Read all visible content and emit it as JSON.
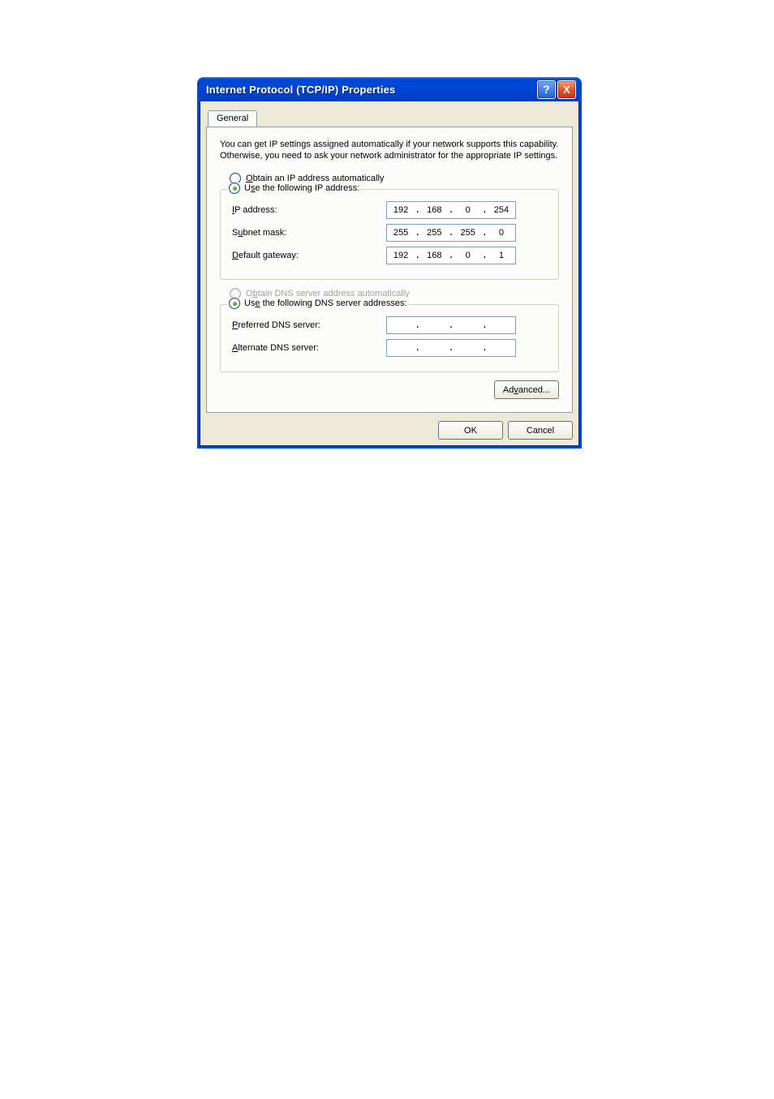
{
  "titlebar": {
    "title": "Internet Protocol (TCP/IP) Properties",
    "help_tooltip": "?",
    "close_tooltip": "X"
  },
  "tab": {
    "general_label": "General"
  },
  "description": "You can get IP settings assigned automatically if your network supports this capability. Otherwise, you need to ask your network administrator for the appropriate IP settings.",
  "ip_section": {
    "radio_auto_o": "O",
    "radio_auto_rest": "btain an IP address automatically",
    "radio_manual_s": "s",
    "radio_manual_pre": "U",
    "radio_manual_rest": "e the following IP address:",
    "ip_label_i": "I",
    "ip_label_rest": "P address:",
    "subnet_label_pre": "S",
    "subnet_label_u": "u",
    "subnet_label_rest": "bnet mask:",
    "gateway_label_d": "D",
    "gateway_label_rest": "efault gateway:",
    "ip": {
      "a": "192",
      "b": "168",
      "c": "0",
      "d": "254"
    },
    "mask": {
      "a": "255",
      "b": "255",
      "c": "255",
      "d": "0"
    },
    "gw": {
      "a": "192",
      "b": "168",
      "c": "0",
      "d": "1"
    }
  },
  "dns_section": {
    "radio_auto_pre": "O",
    "radio_auto_b": "b",
    "radio_auto_rest": "tain DNS server address automatically",
    "radio_manual_pre": "Us",
    "radio_manual_e": "e",
    "radio_manual_rest": " the following DNS server addresses:",
    "pref_p": "P",
    "pref_rest": "referred DNS server:",
    "alt_a": "A",
    "alt_rest": "lternate DNS server:",
    "pref": {
      "a": "",
      "b": "",
      "c": "",
      "d": ""
    },
    "alt": {
      "a": "",
      "b": "",
      "c": "",
      "d": ""
    }
  },
  "buttons": {
    "advanced_pre": "Ad",
    "advanced_v": "v",
    "advanced_rest": "anced...",
    "ok": "OK",
    "cancel": "Cancel"
  }
}
